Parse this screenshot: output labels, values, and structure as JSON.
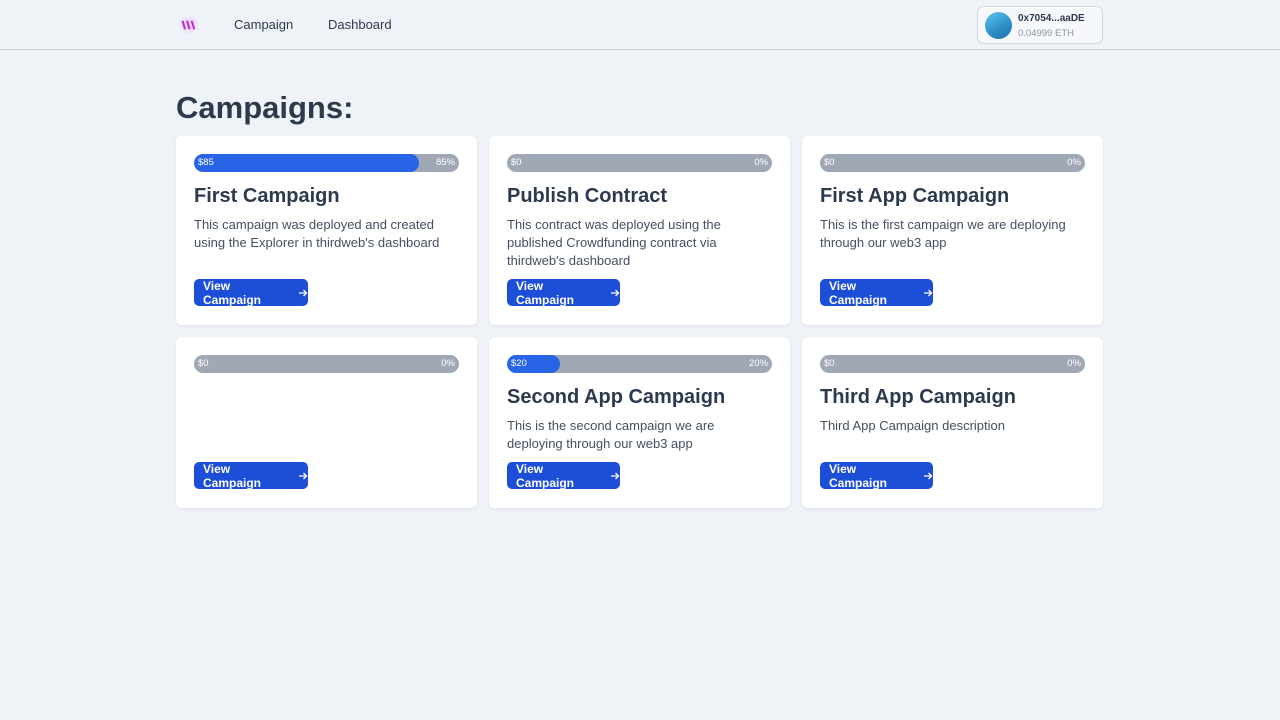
{
  "nav": {
    "logo_icon": "thirdweb-logo-icon",
    "links": [
      "Campaign",
      "Dashboard"
    ]
  },
  "wallet": {
    "address": "0x7054...aaDE",
    "balance": "0.04999 ETH"
  },
  "page": {
    "heading": "Campaigns:"
  },
  "colors": {
    "accent": "#1d4ed8",
    "progress_fill": "#2864e6",
    "progress_track": "#a0a8b5"
  },
  "campaigns": [
    {
      "raised": "$85",
      "percent_label": "85%",
      "progress": 0.85,
      "title": "First Campaign",
      "description": "This campaign was deployed and created using the Explorer in thirdweb's dashboard",
      "button_label": "View Campaign"
    },
    {
      "raised": "$0",
      "percent_label": "0%",
      "progress": 0,
      "title": "Publish Contract",
      "description": "This contract was deployed using the published Crowdfunding contract via thirdweb's dashboard",
      "button_label": "View Campaign"
    },
    {
      "raised": "$0",
      "percent_label": "0%",
      "progress": 0,
      "title": "First App Campaign",
      "description": "This is the first campaign we are deploying through our web3 app",
      "button_label": "View Campaign"
    },
    {
      "raised": "$0",
      "percent_label": "0%",
      "progress": 0,
      "title": "",
      "description": "",
      "button_label": "View Campaign"
    },
    {
      "raised": "$20",
      "percent_label": "20%",
      "progress": 0.2,
      "title": "Second App Campaign",
      "description": "This is the second campaign we are deploying through our web3 app",
      "button_label": "View Campaign"
    },
    {
      "raised": "$0",
      "percent_label": "0%",
      "progress": 0,
      "title": "Third App Campaign",
      "description": "Third App Campaign description",
      "button_label": "View Campaign"
    }
  ]
}
